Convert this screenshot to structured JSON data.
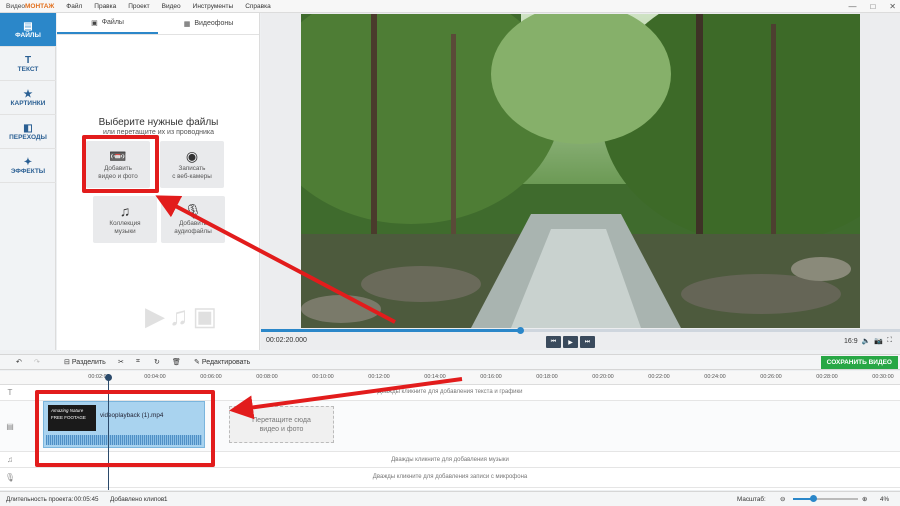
{
  "app": {
    "logo_prefix": "Видео",
    "logo_brand": "МОНТАЖ"
  },
  "menu": [
    "Файл",
    "Правка",
    "Проект",
    "Видео",
    "Инструменты",
    "Справка"
  ],
  "window_controls": [
    "—",
    "□",
    "✕"
  ],
  "nav": {
    "items": [
      {
        "label": "ФАЙЛЫ",
        "icon": "files-icon",
        "active": true
      },
      {
        "label": "ТЕКСТ",
        "icon": "text-icon",
        "active": false
      },
      {
        "label": "КАРТИНКИ",
        "icon": "star-icon",
        "active": false
      },
      {
        "label": "ПЕРЕХОДЫ",
        "icon": "transitions-icon",
        "active": false
      },
      {
        "label": "ЭФФЕКТЫ",
        "icon": "wand-icon",
        "active": false
      }
    ]
  },
  "panel": {
    "tabs": [
      {
        "label": "Файлы"
      },
      {
        "label": "Видеофоны"
      }
    ],
    "title": "Выберите нужные файлы",
    "subtitle": "или перетащите их из проводника",
    "tiles": [
      {
        "label_line1": "Добавить",
        "label_line2": "видео и фото",
        "icon": "film-reel-icon"
      },
      {
        "label_line1": "Записать",
        "label_line2": "с веб-камеры",
        "icon": "webcam-icon"
      },
      {
        "label_line1": "Коллекция",
        "label_line2": "музыки",
        "icon": "music-notes-icon"
      },
      {
        "label_line1": "Добавить",
        "label_line2": "аудиофайлы",
        "icon": "microphone-icon"
      }
    ]
  },
  "player": {
    "timecode": "00:02:20.000",
    "progress": 0.405,
    "aspect": "16:9",
    "buttons": [
      "⏮",
      "▶",
      "⏭"
    ]
  },
  "toolbar": {
    "split_label": "Разделить",
    "edit_label": "Редактировать",
    "save_label": "СОХРАНИТЬ ВИДЕО"
  },
  "ruler": {
    "ticks": [
      "00:02:00",
      "00:04:00",
      "00:06:00",
      "00:08:00",
      "00:10:00",
      "00:12:00",
      "00:14:00",
      "00:16:00",
      "00:18:00",
      "00:20:00",
      "00:22:00",
      "00:24:00",
      "00:26:00",
      "00:28:00",
      "00:30:00"
    ]
  },
  "tracks": {
    "text_hint": "Дважды кликните для добавления текста и графики",
    "music_hint": "Дважды кликните для добавления музыки",
    "mic_hint": "Дважды кликните для добавления записи с микрофона",
    "clip_name": "videoplayback (1).mp4",
    "clip_thumb_line1": "Amazing Nature",
    "clip_thumb_line2": "FREE FOOTAGE",
    "drop_line1": "Перетащите сюда",
    "drop_line2": "видео и фото"
  },
  "status": {
    "duration_label": "Длительность проекта:",
    "duration_value": "00:05:45",
    "clips_label": "Добавлено клипов:",
    "clips_value": "1",
    "zoom_label": "Масштаб:",
    "zoom_value": "4%",
    "zoom_level": 0.3
  },
  "colors": {
    "accent": "#2b87c9",
    "save": "#28a745",
    "annotation": "#e21c1c"
  }
}
